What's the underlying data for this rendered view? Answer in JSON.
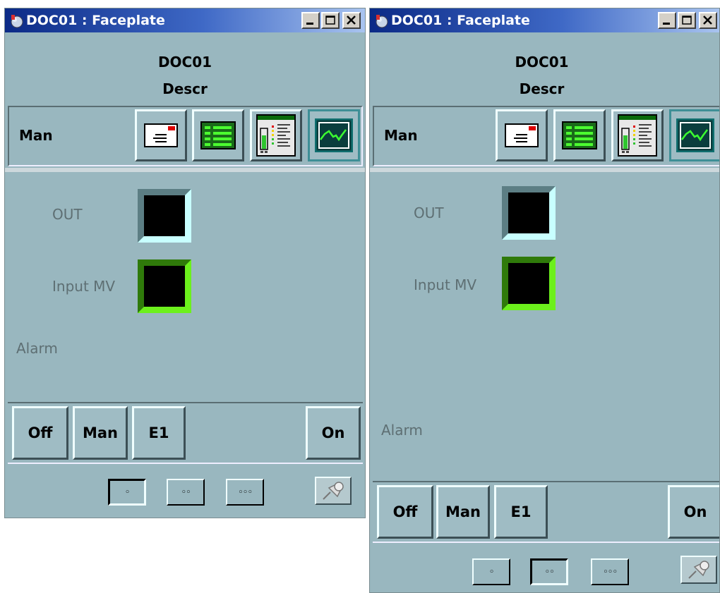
{
  "faceplates": [
    {
      "title": "DOC01 : Faceplate",
      "tag": "DOC01",
      "description": "Descr",
      "mode": "Man",
      "labels": {
        "out": "OUT",
        "input": "Input MV",
        "alarm": "Alarm"
      },
      "commands": [
        "Off",
        "Man",
        "E1",
        "On"
      ],
      "size_buttons": [
        "◦",
        "◦◦",
        "◦◦◦"
      ],
      "active_size": 1
    },
    {
      "title": "DOC01 : Faceplate",
      "tag": "DOC01",
      "description": "Descr",
      "mode": "Man",
      "labels": {
        "out": "OUT",
        "input": "Input MV",
        "alarm": "Alarm"
      },
      "commands": [
        "Off",
        "Man",
        "E1",
        "On"
      ],
      "size_buttons": [
        "◦",
        "◦◦",
        "◦◦◦"
      ],
      "active_size": 2
    }
  ],
  "icons": {
    "app": "faceplate-app-icon",
    "views": [
      "message-view-icon",
      "parameter-list-icon",
      "bargraph-view-icon",
      "trend-view-icon"
    ],
    "pin": "pushpin-icon"
  },
  "colors": {
    "background": "#99b7bf",
    "title_start": "#0b2a86",
    "title_end": "#a9c4f0",
    "out_value_bg": "#000000",
    "input_frame": "#6cf01c"
  }
}
